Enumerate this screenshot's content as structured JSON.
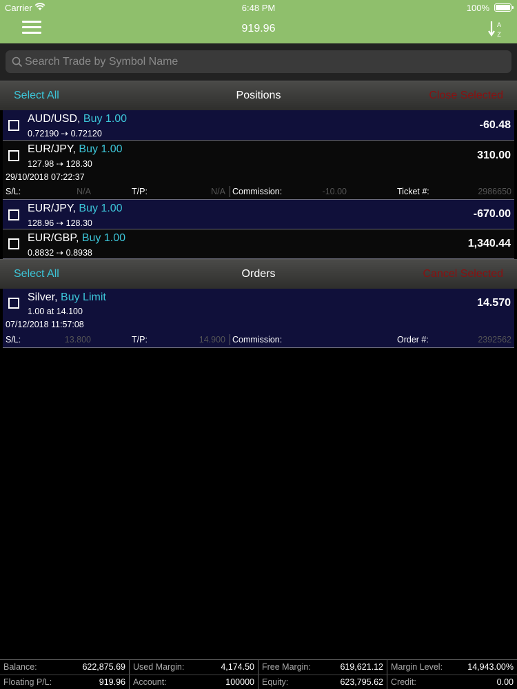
{
  "status_bar": {
    "carrier": "Carrier",
    "time": "6:48 PM",
    "battery": "100%"
  },
  "nav": {
    "title": "919.96",
    "menu_icon": "hamburger-menu-icon",
    "sort_icon": "sort-az-icon"
  },
  "search": {
    "placeholder": "Search Trade by Symbol Name",
    "value": ""
  },
  "positions_section": {
    "select_all": "Select All",
    "title": "Positions",
    "action": "Close Selected"
  },
  "positions": [
    {
      "symbol": "AUD/USD,",
      "action": "Buy 1.00",
      "prices": "0.72190 ⇢ 0.72120",
      "pl": "-60.48"
    },
    {
      "symbol": "EUR/JPY,",
      "action": "Buy 1.00",
      "prices": "127.98 ⇢ 128.30",
      "pl": "310.00",
      "date": "29/10/2018 07:22:37",
      "sl_label": "S/L:",
      "sl_value": "N/A",
      "tp_label": "T/P:",
      "tp_value": "N/A",
      "commission_label": "Commission:",
      "commission_value": "-10.00",
      "ticket_label": "Ticket #:",
      "ticket_value": "2986650"
    },
    {
      "symbol": "EUR/JPY,",
      "action": "Buy 1.00",
      "prices": "128.96 ⇢ 128.30",
      "pl": "-670.00"
    },
    {
      "symbol": "EUR/GBP,",
      "action": "Buy 1.00",
      "prices": "0.8832 ⇢ 0.8938",
      "pl": "1,340.44"
    }
  ],
  "orders_section": {
    "select_all": "Select All",
    "title": "Orders",
    "action": "Cancel Selected"
  },
  "orders": [
    {
      "symbol": "Silver,",
      "action": "Buy Limit",
      "prices": "1.00 at 14.100",
      "price": "14.570",
      "date": "07/12/2018 11:57:08",
      "sl_label": "S/L:",
      "sl_value": "13.800",
      "tp_label": "T/P:",
      "tp_value": "14.900",
      "commission_label": "Commission:",
      "commission_value": "",
      "order_label": "Order #:",
      "order_value": "2392562"
    }
  ],
  "footer": {
    "balance_label": "Balance:",
    "balance": "622,875.69",
    "used_margin_label": "Used Margin:",
    "used_margin": "4,174.50",
    "free_margin_label": "Free Margin:",
    "free_margin": "619,621.12",
    "margin_level_label": "Margin Level:",
    "margin_level": "14,943.00%",
    "floating_pl_label": "Floating P/L:",
    "floating_pl": "919.96",
    "account_label": "Account:",
    "account": "100000",
    "equity_label": "Equity:",
    "equity": "623,795.62",
    "credit_label": "Credit:",
    "credit": "0.00"
  },
  "colors": {
    "nav_green": "#8fbf6c",
    "accent_cyan": "#3cc5d8",
    "action_red": "#8a1010",
    "row_blue": "#10103a"
  }
}
